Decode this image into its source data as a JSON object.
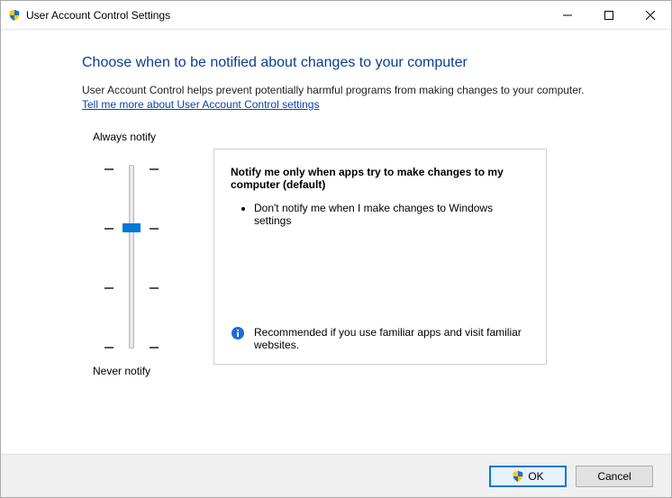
{
  "window": {
    "title": "User Account Control Settings"
  },
  "heading": "Choose when to be notified about changes to your computer",
  "description": "User Account Control helps prevent potentially harmful programs from making changes to your computer.",
  "help_link": "Tell me more about User Account Control settings",
  "slider": {
    "top_label": "Always notify",
    "bottom_label": "Never notify"
  },
  "panel": {
    "title": "Notify me only when apps try to make changes to my computer (default)",
    "bullet1": "Don't notify me when I make changes to Windows settings",
    "footer": "Recommended if you use familiar apps and visit familiar websites."
  },
  "buttons": {
    "ok": "OK",
    "cancel": "Cancel"
  }
}
